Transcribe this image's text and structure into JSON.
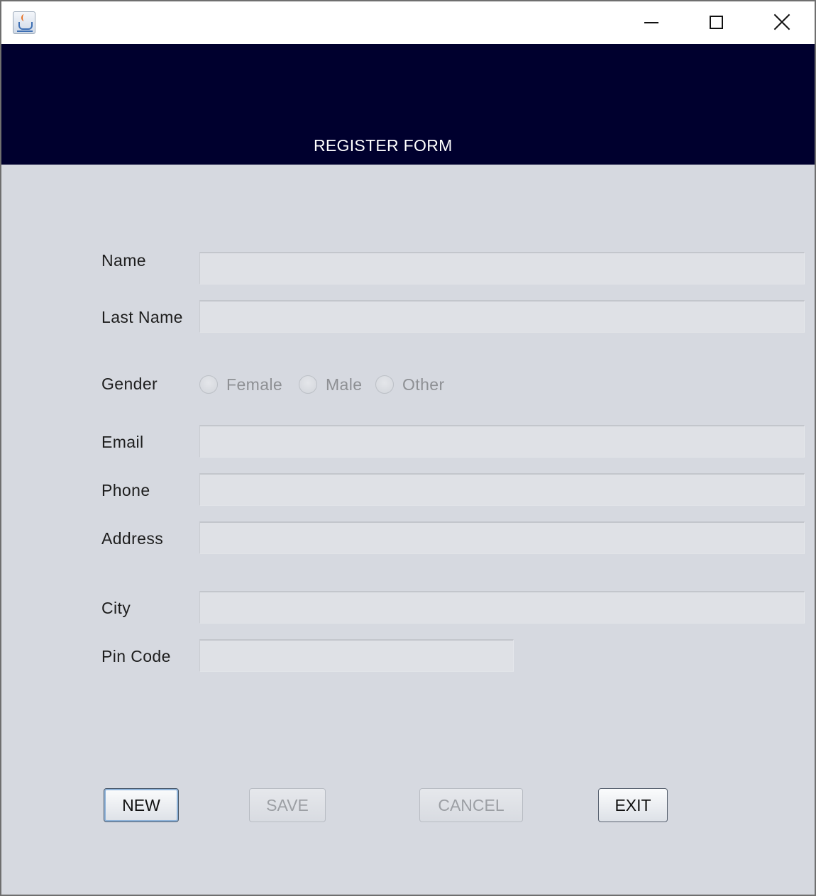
{
  "window": {
    "controls": {
      "minimize_icon": "minimize-icon",
      "maximize_icon": "maximize-icon",
      "close_icon": "close-icon"
    },
    "app_icon": "java-icon"
  },
  "header": {
    "title": "REGISTER FORM",
    "background": "#00002e"
  },
  "form": {
    "name_label": "Name",
    "name_value": "",
    "last_name_label": "Last Name",
    "last_name_value": "",
    "gender_label": "Gender",
    "gender_options": [
      "Female",
      "Male",
      "Other"
    ],
    "email_label": "Email",
    "email_value": "",
    "phone_label": "Phone",
    "phone_value": "",
    "address_label": "Address",
    "address_value": "",
    "city_label": "City",
    "city_value": "",
    "pin_label": "Pin Code",
    "pin_value": ""
  },
  "buttons": {
    "new": "NEW",
    "save": "SAVE",
    "cancel": "CANCEL",
    "exit": "EXIT"
  }
}
